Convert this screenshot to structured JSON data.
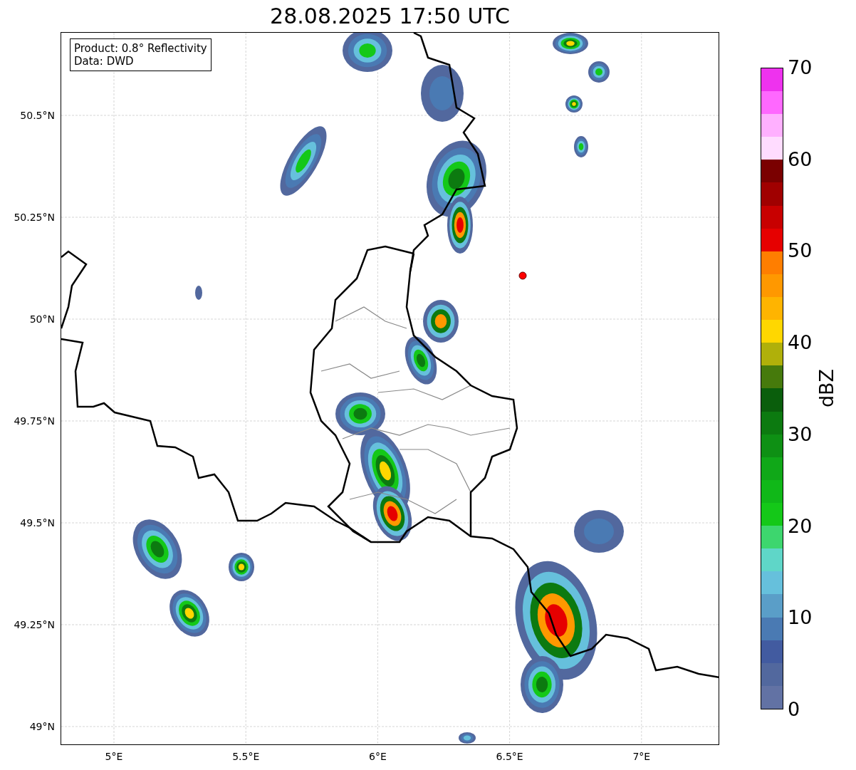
{
  "title": "28.08.2025 17:50 UTC",
  "map": {
    "info_lines": [
      "Product: 0.8° Reflectivity",
      "Data: DWD"
    ],
    "lat_ticks": [
      "50.5°N",
      "50.25°N",
      "50°N",
      "49.75°N",
      "49.5°N",
      "49.25°N",
      "49°N"
    ],
    "lon_ticks": [
      "5°E",
      "5.5°E",
      "6°E",
      "6.5°E",
      "7°E"
    ]
  },
  "colorbar": {
    "label": "dBZ",
    "ticks": [
      "70",
      "60",
      "50",
      "40",
      "30",
      "20",
      "10",
      "0"
    ],
    "bands": [
      {
        "color": "#6272a4"
      },
      {
        "color": "#52689e"
      },
      {
        "color": "#425ba0"
      },
      {
        "color": "#4a7ab3"
      },
      {
        "color": "#5a9ec8"
      },
      {
        "color": "#66c0dc"
      },
      {
        "color": "#5fd6c8"
      },
      {
        "color": "#3dd66e"
      },
      {
        "color": "#14c818"
      },
      {
        "color": "#10b818"
      },
      {
        "color": "#10a818"
      },
      {
        "color": "#0e9014"
      },
      {
        "color": "#0c7a10"
      },
      {
        "color": "#0a5e0c"
      },
      {
        "color": "#467a0c"
      },
      {
        "color": "#b0b00a"
      },
      {
        "color": "#ffd700"
      },
      {
        "color": "#ffb400"
      },
      {
        "color": "#ff9800"
      },
      {
        "color": "#ff7e00"
      },
      {
        "color": "#e60000"
      },
      {
        "color": "#c80000"
      },
      {
        "color": "#a00000"
      },
      {
        "color": "#7a0000"
      },
      {
        "color": "#ffdcff"
      },
      {
        "color": "#ffb0ff"
      },
      {
        "color": "#ff68ff"
      },
      {
        "color": "#ee32ee"
      }
    ]
  }
}
